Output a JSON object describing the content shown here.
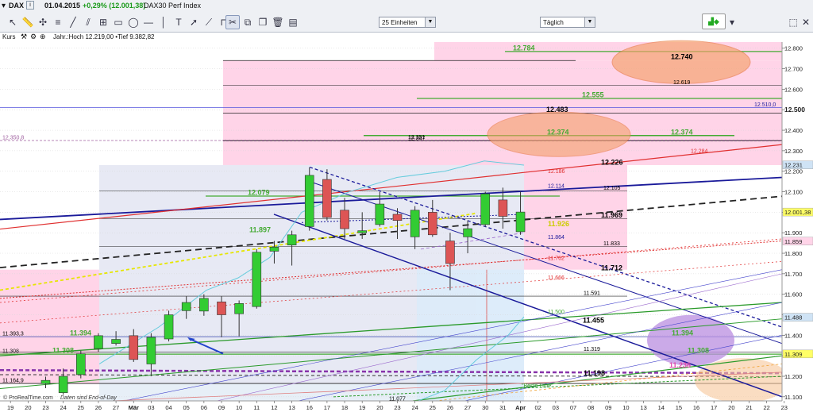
{
  "header": {
    "symbol": "DAX",
    "info_icon": "info-icon",
    "date": "01.04.2015",
    "change": "+0,29% (12.001,38)",
    "name": "DAX30 Perf Index"
  },
  "toolbar": {
    "period_select": "25 Einheiten",
    "interval_select": "Täglich",
    "icons": [
      "cursor-icon",
      "ruler-icon",
      "crosshair-icon",
      "fibonacci-icon",
      "trendline-icon",
      "channel-icon",
      "zoom-box-icon",
      "rectangle-icon",
      "ellipse-icon",
      "horizontal-line-icon",
      "vertical-line-icon",
      "text-icon",
      "arrow-icon",
      "fan-icon",
      "magnet-icon",
      "settings-icon",
      "layers-icon",
      "copy-icon",
      "paste-icon",
      "delete-icon",
      "trash-icon",
      "save-icon"
    ],
    "right_icons": [
      "indicator-icon",
      "chevron-down-icon",
      "expand-icon",
      "close-icon"
    ]
  },
  "indicator_bar": {
    "label": "Kurs",
    "meta": "Jahr.:Hoch 12.219,00 •Tief 9.382,82"
  },
  "credit": {
    "source": "© ProRealTime.com",
    "note": "Daten sind End-of-Day"
  },
  "colors": {
    "up": "#33cc33",
    "down": "#dd5555",
    "pink": "#ffd4e8",
    "lightblue": "#e3ecf6",
    "axis_highlight_green": "#ffff00",
    "blue_line": "#1a1a9a",
    "red_line": "#e03030"
  },
  "chart_data": {
    "type": "candlestick",
    "ylim": [
      11080,
      12830
    ],
    "y_ticks": [
      11100,
      11200,
      11300,
      11400,
      11500,
      11600,
      11700,
      11800,
      11900,
      12000,
      12100,
      12200,
      12300,
      12400,
      12500,
      12600,
      12700,
      12800
    ],
    "y_tick_labels": [
      "11.100",
      "11.200",
      "11.300",
      "11.400",
      "11.500",
      "11.600",
      "11.700",
      "11.800",
      "11.900",
      "12.000",
      "12.100",
      "12.200",
      "12.300",
      "12.400",
      "12.500",
      "12.600",
      "12.700",
      "12.800"
    ],
    "y_bold_tick": "12.500",
    "x_labels": [
      "19",
      "20",
      "23",
      "24",
      "25",
      "26",
      "27",
      "Mär",
      "03",
      "04",
      "05",
      "06",
      "09",
      "10",
      "11",
      "12",
      "13",
      "16",
      "17",
      "18",
      "19",
      "20",
      "23",
      "24",
      "25",
      "26",
      "27",
      "30",
      "31",
      "Apr",
      "02",
      "03",
      "07",
      "08",
      "09",
      "10",
      "13",
      "14",
      "15",
      "16",
      "17",
      "20",
      "21",
      "22",
      "23"
    ],
    "candles": [
      {
        "d": "23",
        "o": 11164,
        "h": 11198,
        "l": 11142,
        "c": 11180
      },
      {
        "d": "24",
        "o": 11120,
        "h": 11238,
        "l": 11110,
        "c": 11200
      },
      {
        "d": "25",
        "o": 11208,
        "h": 11325,
        "l": 11190,
        "c": 11310
      },
      {
        "d": "26",
        "o": 11335,
        "h": 11410,
        "l": 11320,
        "c": 11398
      },
      {
        "d": "27",
        "o": 11360,
        "h": 11420,
        "l": 11350,
        "c": 11380
      },
      {
        "d": "Mär",
        "o": 11398,
        "h": 11430,
        "l": 11270,
        "c": 11282
      },
      {
        "d": "03",
        "o": 11260,
        "h": 11410,
        "l": 11200,
        "c": 11390
      },
      {
        "d": "04",
        "o": 11382,
        "h": 11520,
        "l": 11370,
        "c": 11500
      },
      {
        "d": "05",
        "o": 11520,
        "h": 11590,
        "l": 11480,
        "c": 11560
      },
      {
        "d": "06",
        "o": 11518,
        "h": 11600,
        "l": 11495,
        "c": 11580
      },
      {
        "d": "09",
        "o": 11563,
        "h": 11590,
        "l": 11390,
        "c": 11500
      },
      {
        "d": "10",
        "o": 11505,
        "h": 11570,
        "l": 11395,
        "c": 11555
      },
      {
        "d": "11",
        "o": 11540,
        "h": 11820,
        "l": 11530,
        "c": 11805
      },
      {
        "d": "12",
        "o": 11810,
        "h": 11860,
        "l": 11750,
        "c": 11830
      },
      {
        "d": "13",
        "o": 11840,
        "h": 11910,
        "l": 11740,
        "c": 11890
      },
      {
        "d": "16",
        "o": 11930,
        "h": 12219,
        "l": 11910,
        "c": 12180
      },
      {
        "d": "17",
        "o": 12160,
        "h": 12210,
        "l": 11960,
        "c": 11975
      },
      {
        "d": "18",
        "o": 12010,
        "h": 12070,
        "l": 11870,
        "c": 11920
      },
      {
        "d": "19",
        "o": 11900,
        "h": 12000,
        "l": 11870,
        "c": 11910
      },
      {
        "d": "20",
        "o": 11940,
        "h": 12100,
        "l": 11930,
        "c": 12040
      },
      {
        "d": "23",
        "o": 11990,
        "h": 12020,
        "l": 11870,
        "c": 11960
      },
      {
        "d": "24",
        "o": 11880,
        "h": 12030,
        "l": 11820,
        "c": 12010
      },
      {
        "d": "25",
        "o": 12000,
        "h": 12060,
        "l": 11880,
        "c": 11890
      },
      {
        "d": "26",
        "o": 11860,
        "h": 11900,
        "l": 11620,
        "c": 11750
      },
      {
        "d": "27",
        "o": 11880,
        "h": 11960,
        "l": 11800,
        "c": 11920
      },
      {
        "d": "30",
        "o": 11940,
        "h": 12100,
        "l": 11930,
        "c": 12090
      },
      {
        "d": "31",
        "o": 12060,
        "h": 12120,
        "l": 11920,
        "c": 11980
      },
      {
        "d": "Apr",
        "o": 11905,
        "h": 12100,
        "l": 11890,
        "c": 12001
      }
    ],
    "h_levels": [
      {
        "v": 12784,
        "label": "12.784",
        "color": "#44aa33",
        "bold": true
      },
      {
        "v": 12740,
        "label": "12.740",
        "color": "#000000",
        "bold": true
      },
      {
        "v": 12619,
        "label": "12.619",
        "color": "#000000",
        "bold": false
      },
      {
        "v": 12555,
        "label": "12.555",
        "color": "#44aa33",
        "bold": true
      },
      {
        "v": 12510,
        "label": "12.510,0",
        "color": "#1a1a9a",
        "bold": false
      },
      {
        "v": 12483,
        "label": "12.483",
        "color": "#000000",
        "bold": true
      },
      {
        "v": 12374,
        "label": "12.374",
        "color": "#44aa33",
        "bold": true
      },
      {
        "v": 12351,
        "label": "12.351",
        "color": "#000000",
        "bold": false
      },
      {
        "v": 12350,
        "label": "12.350,8",
        "color": "#a060a0",
        "bold": false
      },
      {
        "v": 12347,
        "label": "12.347",
        "color": "#000000",
        "bold": false
      },
      {
        "v": 12284,
        "label": "12.284",
        "color": "#e03030",
        "bold": false
      },
      {
        "v": 12226,
        "label": "12.226",
        "color": "#000000",
        "bold": true
      },
      {
        "v": 12186,
        "label": "12.186",
        "color": "#e03030",
        "bold": false
      },
      {
        "v": 12114,
        "label": "12.114",
        "color": "#1a1a9a",
        "bold": false
      },
      {
        "v": 12105,
        "label": "12.105",
        "color": "#000000",
        "bold": false
      },
      {
        "v": 12079,
        "label": "12.079",
        "color": "#44aa33",
        "bold": true
      },
      {
        "v": 11969,
        "label": "11.969",
        "color": "#000000",
        "bold": true
      },
      {
        "v": 11926,
        "label": "11.926",
        "color": "#cccc00",
        "bold": true
      },
      {
        "v": 11897,
        "label": "11.897",
        "color": "#44aa33",
        "bold": true
      },
      {
        "v": 11864,
        "label": "11.864",
        "color": "#1a1a9a",
        "bold": false
      },
      {
        "v": 11833,
        "label": "11.833",
        "color": "#000000",
        "bold": false
      },
      {
        "v": 11762,
        "label": "11.762",
        "color": "#e03030",
        "bold": false
      },
      {
        "v": 11712,
        "label": "11.712",
        "color": "#000000",
        "bold": true
      },
      {
        "v": 11666,
        "label": "11.666",
        "color": "#e03030",
        "bold": false
      },
      {
        "v": 11591,
        "label": "11.591",
        "color": "#000000",
        "bold": false
      },
      {
        "v": 11500,
        "label": "11.500",
        "color": "#44aa33",
        "bold": false
      },
      {
        "v": 11455,
        "label": "11.455",
        "color": "#000000",
        "bold": true
      },
      {
        "v": 11394,
        "label": "11.394",
        "color": "#44aa33",
        "bold": true
      },
      {
        "v": 11393,
        "label": "11.393,3",
        "color": "#000000",
        "bold": false
      },
      {
        "v": 11319,
        "label": "11.319",
        "color": "#000000",
        "bold": false
      },
      {
        "v": 11308,
        "label": "11.308",
        "color": "#44aa33",
        "bold": true
      },
      {
        "v": 11236,
        "label": "11.236",
        "color": "#dd44aa",
        "bold": true
      },
      {
        "v": 11198,
        "label": "11.198",
        "color": "#000000",
        "bold": true
      },
      {
        "v": 11165,
        "label": "11.164,9",
        "color": "#000000",
        "bold": false
      },
      {
        "v": 11077,
        "label": "11.077",
        "color": "#000000",
        "bold": false
      }
    ],
    "right_axis_tags": [
      {
        "v": 12231,
        "label": "12.231",
        "bg": "#cfe3f5"
      },
      {
        "v": 12001,
        "label": "12.001,38",
        "bg": "#ffff66"
      },
      {
        "v": 11859,
        "label": "11.859",
        "bg": "#ffd4e8"
      },
      {
        "v": 11488,
        "label": "11.488",
        "bg": "#cfe3f5"
      },
      {
        "v": 11309,
        "label": "11.309",
        "bg": "#ffff66"
      }
    ],
    "annotation_text": "\"Beste Linie\""
  }
}
